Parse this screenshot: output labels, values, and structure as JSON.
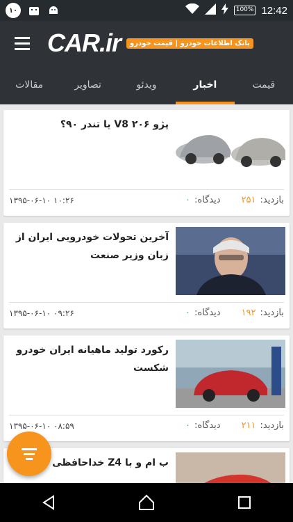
{
  "status_bar": {
    "notification_count": "۱۰",
    "battery": "100%",
    "time": "12:42"
  },
  "header": {
    "logo_text": "CAR.ir",
    "tagline": "بانک اطلاعات خودرو | قیمت خودرو"
  },
  "tabs": [
    {
      "label": "قیمت",
      "active": false
    },
    {
      "label": "اخبار",
      "active": true
    },
    {
      "label": "ویدئو",
      "active": false
    },
    {
      "label": "تصاویر",
      "active": false
    },
    {
      "label": "مقالات",
      "active": false
    }
  ],
  "articles": [
    {
      "title": "پژو ۲۰۶ V8 یا تندر ۹۰؟",
      "views_label": "بازدید:",
      "views": "۲۵۱",
      "comments_label": "دیدگاه:",
      "comments": "۰",
      "date": "۱۳۹۵-۰۶-۱۰ ۱۰:۲۶"
    },
    {
      "title": "آخرین تحولات خودرویی ایران از زبان وزیر صنعت",
      "views_label": "بازدید:",
      "views": "۱۹۲",
      "comments_label": "دیدگاه:",
      "comments": "۰",
      "date": "۱۳۹۵-۰۶-۱۰ ۰۹:۲۶"
    },
    {
      "title": "رکورد تولید ماهیانه ایران خودرو شکست",
      "views_label": "بازدید:",
      "views": "۲۱۱",
      "comments_label": "دیدگاه:",
      "comments": "۰",
      "date": "۱۳۹۵-۰۶-۱۰ ۰۸:۵۹"
    },
    {
      "title": "ب ام و با Z4 خداحافظی کرد"
    }
  ],
  "colors": {
    "accent": "#f7941d",
    "header_bg": "#2f3338",
    "comment_count": "#4caf50"
  }
}
